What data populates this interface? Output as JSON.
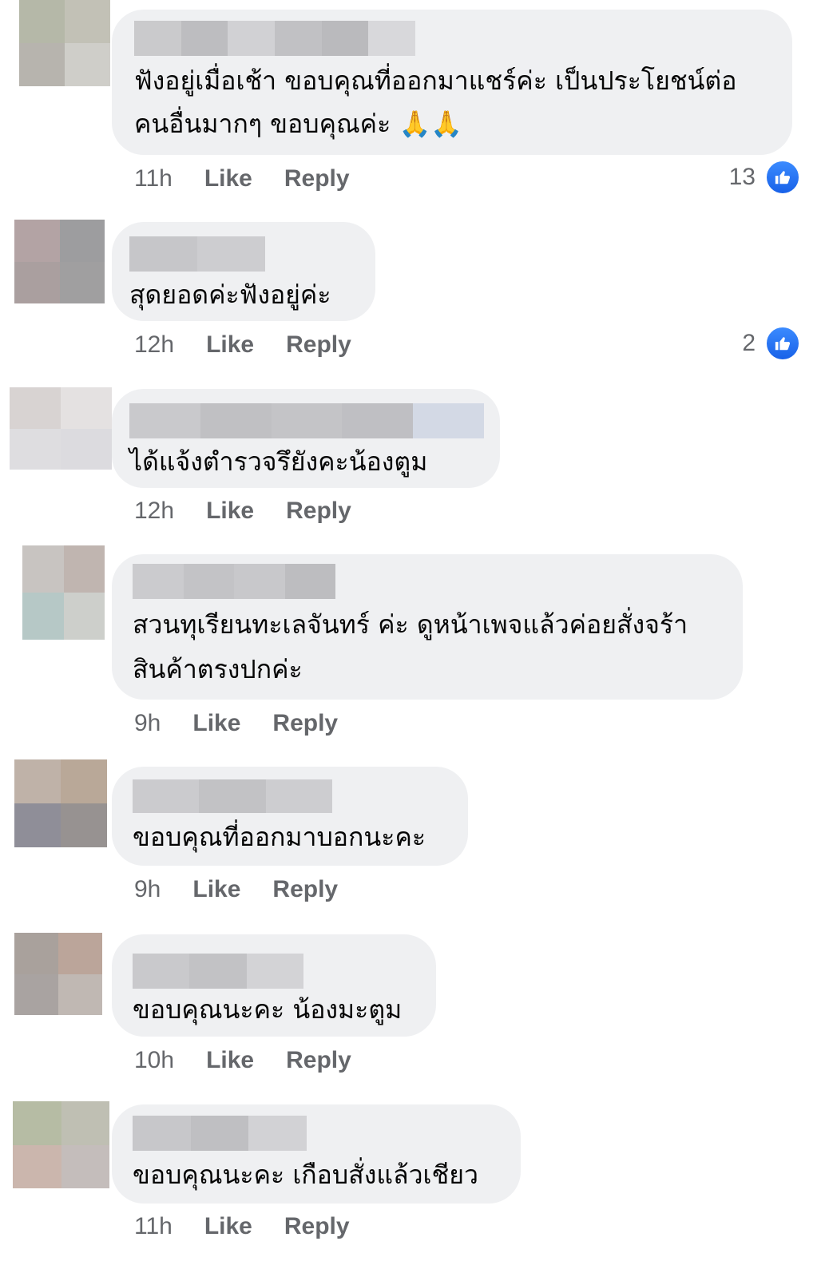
{
  "comments": [
    {
      "text": "ฟังอยู่เมื่อเช้า ขอบคุณที่ออกมาแชร์ค่ะ เป็นประโยชน์ต่อ\nคนอื่นมากๆ ขอบคุณค่ะ 🙏🙏",
      "time": "11h",
      "like": "Like",
      "reply": "Reply",
      "reaction_count": "13",
      "avatar_colors": [
        "#b5b8a8",
        "#c2c1b6",
        "#b7b4ae",
        "#cfcec9"
      ],
      "name_colors": [
        "#cacacc",
        "#bdbdc0",
        "#d1d1d4",
        "#c1c1c4",
        "#bababd",
        "#d8d8db"
      ]
    },
    {
      "text": "สุดยอดค่ะฟังอยู่ค่ะ",
      "time": "12h",
      "like": "Like",
      "reply": "Reply",
      "reaction_count": "2",
      "avatar_colors": [
        "#b3a3a4",
        "#9d9d9f",
        "#aa9f9f",
        "#a09fa0"
      ],
      "name_colors": [
        "#c6c6c9",
        "#cdcdd0"
      ]
    },
    {
      "text": "ได้แจ้งตำรวจรึยังคะน้องตูม",
      "time": "12h",
      "like": "Like",
      "reply": "Reply",
      "reaction_count": "",
      "avatar_colors": [
        "#d8d3d2",
        "#e4e1e1",
        "#dedde0",
        "#dcdbdf"
      ],
      "name_colors": [
        "#c9c9cc",
        "#c0c0c3",
        "#c4c4c7",
        "#bfbfc3",
        "#d3d9e5"
      ]
    },
    {
      "text": "สวนทุเรียนทะเลจันทร์ ค่ะ ดูหน้าเพจแล้วค่อยสั่งจร้า\nสินค้าตรงปกค่ะ",
      "time": "9h",
      "like": "Like",
      "reply": "Reply",
      "reaction_count": "",
      "avatar_colors": [
        "#c8c4c1",
        "#c0b5b0",
        "#b6c8c6",
        "#cdcfcb"
      ],
      "name_colors": [
        "#cbcbce",
        "#c3c3c6",
        "#c8c8cb",
        "#bdbdc0"
      ]
    },
    {
      "text": "ขอบคุณที่ออกมาบอกนะคะ",
      "time": "9h",
      "like": "Like",
      "reply": "Reply",
      "reaction_count": "",
      "avatar_colors": [
        "#bfb2a8",
        "#b9a898",
        "#8f8e98",
        "#979291"
      ],
      "name_colors": [
        "#cbcbce",
        "#c2c2c5",
        "#cdcdd0"
      ]
    },
    {
      "text": "ขอบคุณนะคะ น้องมะตูม",
      "time": "10h",
      "like": "Like",
      "reply": "Reply",
      "reaction_count": "",
      "avatar_colors": [
        "#a9a19c",
        "#bba59a",
        "#a9a3a1",
        "#c0b8b3"
      ],
      "name_colors": [
        "#c9c9cc",
        "#c2c2c5",
        "#d3d3d6"
      ]
    },
    {
      "text": "ขอบคุณนะคะ เกือบสั่งแล้วเชียว",
      "time": "11h",
      "like": "Like",
      "reply": "Reply",
      "reaction_count": "",
      "avatar_colors": [
        "#b6bca4",
        "#bfbfb3",
        "#cbb6ad",
        "#c4bdbb"
      ],
      "name_colors": [
        "#c7c7ca",
        "#bfbfc2",
        "#d2d2d5"
      ]
    }
  ],
  "colors": {
    "bubble": "#eff0f2",
    "meta_text": "#65676b",
    "like_badge": "#1877f2"
  },
  "icons": {
    "reaction": "thumbs-up-icon",
    "emoji": "folded-hands-emoji"
  }
}
